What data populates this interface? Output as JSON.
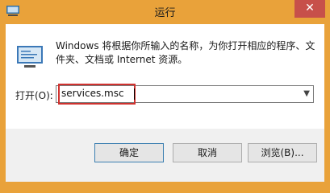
{
  "window": {
    "title": "运行",
    "close_glyph": "✕",
    "accent": "#e9a23a",
    "close_color": "#c7504a"
  },
  "content": {
    "description": "Windows 将根据你所输入的名称，为你打开相应的程序、文件夹、文档或 Internet 资源。",
    "open_label": "打开(O):",
    "input_value": "services.msc",
    "dropdown_icon": "chevron-down-icon",
    "highlight_color": "#d0322f"
  },
  "buttons": {
    "ok": "确定",
    "cancel": "取消",
    "browse": "浏览(B)..."
  }
}
